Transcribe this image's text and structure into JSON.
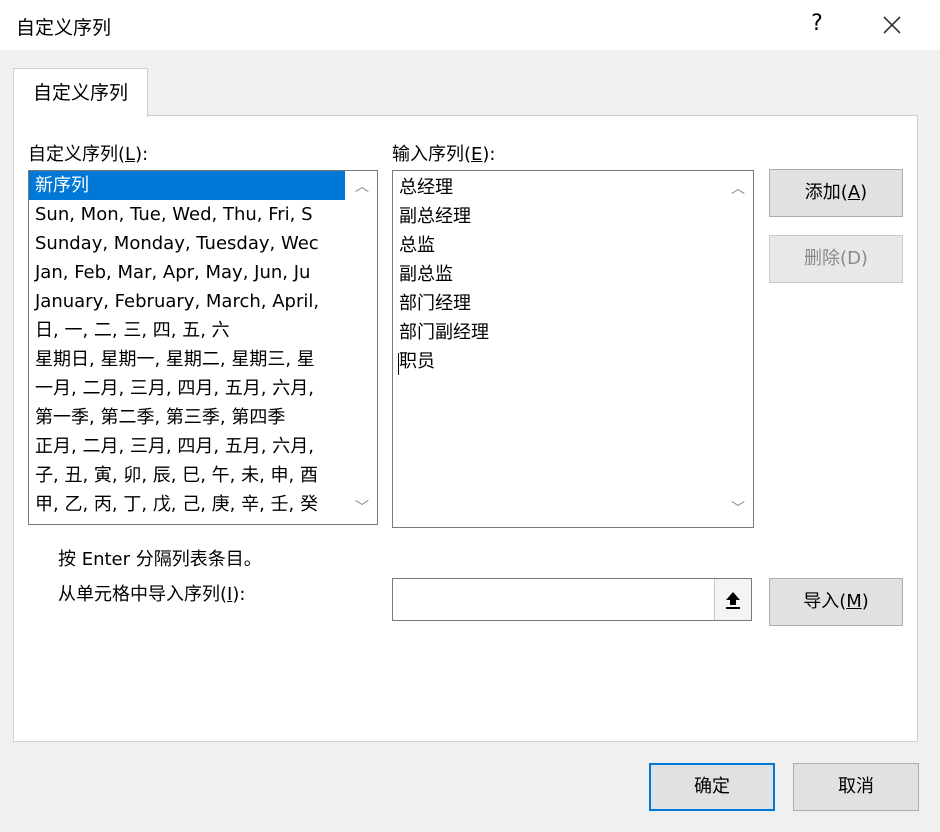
{
  "window": {
    "title": "自定义序列",
    "help": "?",
    "close_icon": "close-icon"
  },
  "tab": {
    "label": "自定义序列"
  },
  "custom_lists": {
    "label_prefix": "自定义序列(",
    "label_key": "L",
    "label_suffix": "):",
    "items": [
      "新序列",
      "Sun, Mon, Tue, Wed, Thu, Fri, S",
      "Sunday, Monday, Tuesday, Wec",
      "Jan, Feb, Mar, Apr, May, Jun, Ju",
      "January, February, March, April,",
      "日, 一, 二, 三, 四, 五, 六",
      "星期日, 星期一, 星期二, 星期三, 星",
      "一月, 二月, 三月, 四月, 五月, 六月,",
      "第一季, 第二季, 第三季, 第四季",
      "正月, 二月, 三月, 四月, 五月, 六月,",
      "子, 丑, 寅, 卯, 辰, 巳, 午, 未, 申, 酉",
      "甲, 乙, 丙, 丁, 戊, 己, 庚, 辛, 壬, 癸"
    ],
    "selected_index": 0
  },
  "entries": {
    "label_prefix": "输入序列(",
    "label_key": "E",
    "label_suffix": "):",
    "lines": [
      "总经理",
      "副总经理",
      "总监",
      "副总监",
      "部门经理",
      "部门副经理",
      "职员"
    ]
  },
  "buttons": {
    "add": {
      "prefix": "添加(",
      "key": "A",
      "suffix": ")"
    },
    "delete": {
      "label": "删除(D)"
    },
    "import": {
      "prefix": "导入(",
      "key": "M",
      "suffix": ")"
    },
    "ok": "确定",
    "cancel": "取消"
  },
  "hint": "按 Enter 分隔列表条目。",
  "import_from_cells": {
    "label_prefix": "从单元格中导入序列(",
    "label_key": "I",
    "label_suffix": "):",
    "value": ""
  },
  "colors": {
    "selection": "#0078d7",
    "default_button_border": "#0078d7",
    "panel": "#ffffff",
    "background": "#f0f0f0"
  }
}
